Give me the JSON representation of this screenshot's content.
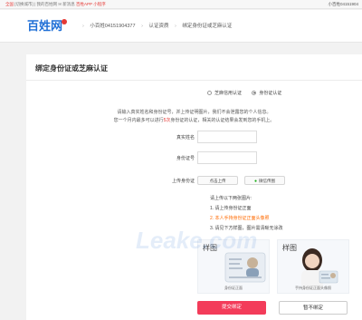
{
  "topbar": {
    "left": [
      {
        "text": "全国",
        "style": "red"
      },
      {
        "text": "[切换城市]",
        "style": "gray"
      },
      {
        "text": " | 我的百姓网",
        "style": "gray"
      },
      {
        "text": "  ✉ 新消息",
        "style": "gray"
      },
      {
        "text": "  百姓APP",
        "style": "red"
      },
      {
        "text": "  小程序",
        "style": "red"
      }
    ],
    "right": "小百姓04151904"
  },
  "header": {
    "logo": "百姓网",
    "breadcrumbs": [
      "小百姓04151904377",
      "认证资质",
      "绑定身份证或芝麻认证"
    ]
  },
  "card": {
    "title": "绑定身份证或芝麻认证",
    "radios": [
      {
        "label": "芝麻信用认证",
        "selected": false
      },
      {
        "label": "身份证认证",
        "selected": true
      }
    ],
    "intro_line1": "请输入真实姓名和身份证号，并上传证明图片，我们不会泄露您的个人信息。",
    "intro_line2_pre": "您一个月内最多可以进行",
    "intro_line2_hl": "5次",
    "intro_line2_post": "身份证的认证，相关的认证结果会发到您的手机上。",
    "fields": [
      {
        "label": "真实姓名",
        "value": ""
      },
      {
        "label": "身份证号",
        "value": ""
      }
    ],
    "upload": {
      "label": "上传身份证",
      "btn_local": "点击上传",
      "btn_wechat": "微信传图"
    },
    "steps": {
      "heading": "请上传以下两张图片:",
      "step1": "1. 请上传身份证正面",
      "step2": "2. 本人手持身份证正面头像照",
      "step3": "3. 请见下方样图，图片需清晰无涂改"
    },
    "samples": [
      {
        "tag": "样图",
        "caption": "身份证正面"
      },
      {
        "tag": "样图",
        "caption": "手持身份证正面头像照"
      }
    ],
    "submit": "提交绑定",
    "cancel": "暂不绑定"
  },
  "watermark": "Leake.com"
}
